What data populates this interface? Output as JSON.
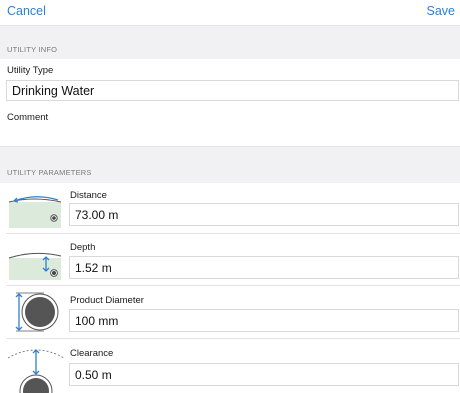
{
  "topbar": {
    "cancel_label": "Cancel",
    "save_label": "Save",
    "accent_color": "#2f80d0"
  },
  "utility_info": {
    "header": "UTILITY INFO",
    "utility_type_label": "Utility Type",
    "utility_type_value": "Drinking Water",
    "comment_label": "Comment",
    "comment_value": ""
  },
  "utility_parameters": {
    "header": "UTILITY PARAMETERS",
    "items": [
      {
        "icon": "distance-diagram-icon",
        "label": "Distance",
        "value": "73.00 m"
      },
      {
        "icon": "depth-diagram-icon",
        "label": "Depth",
        "value": "1.52 m"
      },
      {
        "icon": "product-diameter-diagram-icon",
        "label": "Product Diameter",
        "value": "100 mm"
      },
      {
        "icon": "clearance-diagram-icon",
        "label": "Clearance",
        "value": "0.50 m"
      }
    ]
  }
}
